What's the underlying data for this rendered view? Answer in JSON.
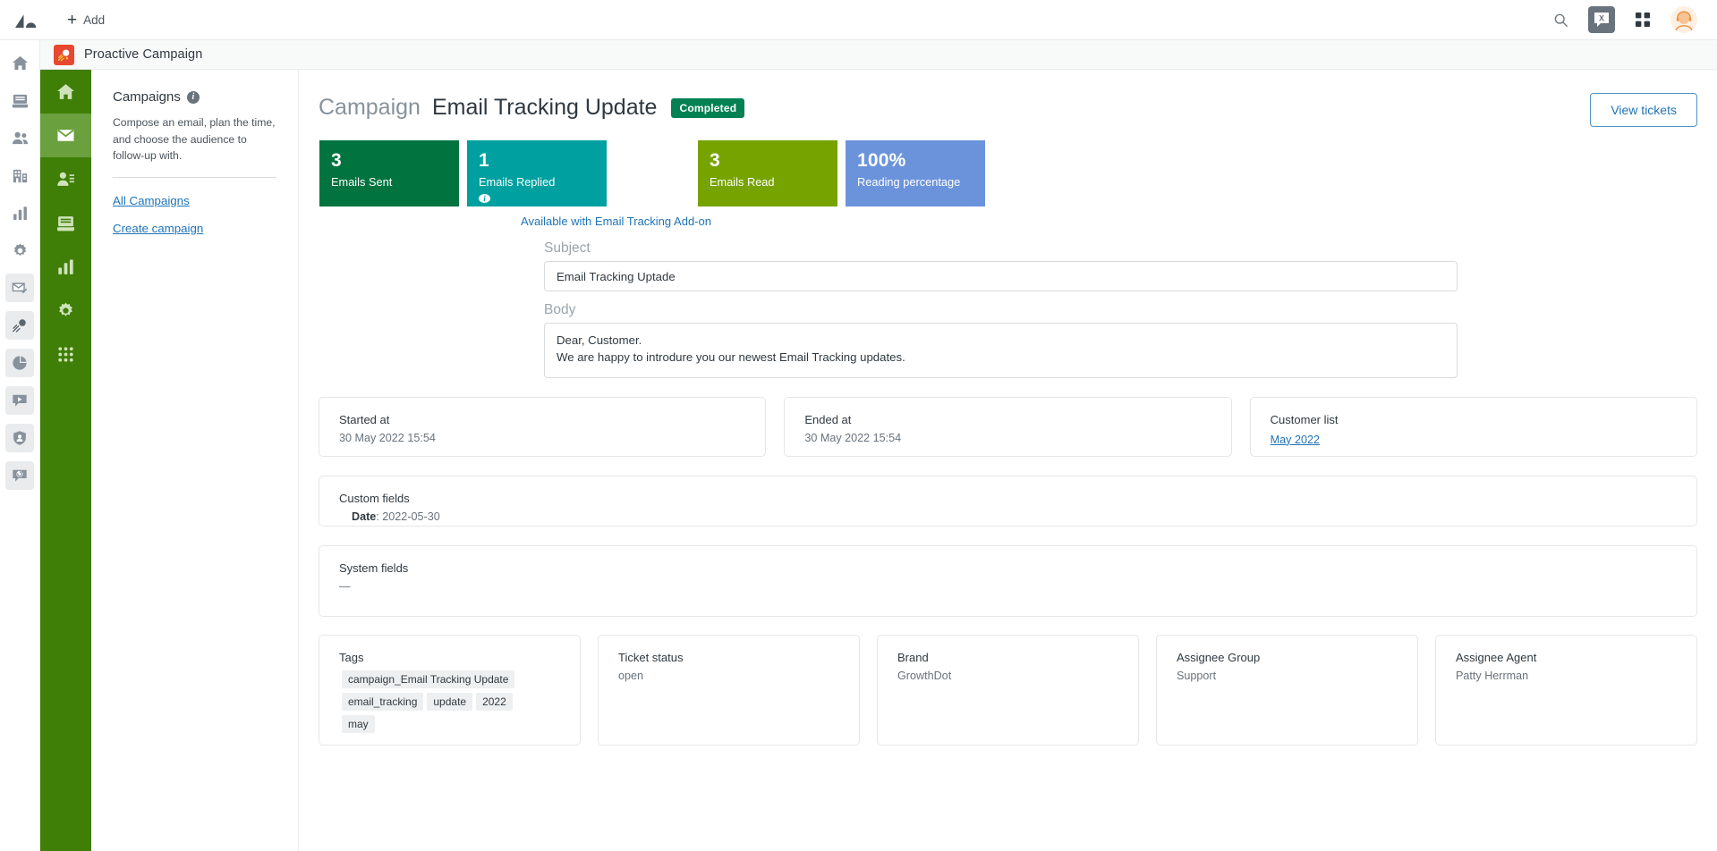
{
  "topbar": {
    "add_label": "Add",
    "icons": [
      {
        "name": "search-icon",
        "label": "Search"
      },
      {
        "name": "apps-tile-icon",
        "label": "Zendesk Apps"
      },
      {
        "name": "grid-icon",
        "label": "Products"
      },
      {
        "name": "avatar",
        "label": "User profile"
      }
    ]
  },
  "rail": {
    "items": [
      {
        "name": "home-icon",
        "label": "Home",
        "tile": false
      },
      {
        "name": "views-icon",
        "label": "Views",
        "tile": false
      },
      {
        "name": "customers-icon",
        "label": "Customers",
        "tile": false
      },
      {
        "name": "organizations-icon",
        "label": "Organizations",
        "tile": false
      },
      {
        "name": "reporting-icon",
        "label": "Reporting",
        "tile": false
      },
      {
        "name": "gear-icon",
        "label": "Admin",
        "tile": false
      },
      {
        "name": "email-tracking-icon",
        "label": "Email Tracking",
        "tile": true
      },
      {
        "name": "proactive-campaign-icon",
        "label": "Proactive Campaign",
        "tile": true
      },
      {
        "name": "pie-chart-icon",
        "label": "Analytics",
        "tile": true
      },
      {
        "name": "video-reply-icon",
        "label": "Video Reply",
        "tile": true
      },
      {
        "name": "shield-user-icon",
        "label": "GDPR Compliance",
        "tile": true
      },
      {
        "name": "ticket-share-icon",
        "label": "Ticket Sharing",
        "tile": true
      }
    ]
  },
  "product_header": {
    "title": "Proactive Campaign",
    "logo_name": "proactive-campaign-logo"
  },
  "greenbar": {
    "items": [
      {
        "name": "green-home-icon",
        "label": "Home",
        "active": false
      },
      {
        "name": "green-campaigns-icon",
        "label": "Campaigns",
        "active": true
      },
      {
        "name": "green-customer-lists-icon",
        "label": "Customer lists",
        "active": false
      },
      {
        "name": "green-templates-icon",
        "label": "Templates",
        "active": false
      },
      {
        "name": "green-reports-icon",
        "label": "Reports",
        "active": false
      },
      {
        "name": "green-settings-icon",
        "label": "Settings",
        "active": false
      },
      {
        "name": "green-apps-icon",
        "label": "Apps",
        "active": false
      }
    ]
  },
  "panel": {
    "title": "Campaigns",
    "description": "Compose an email, plan the time, and choose the audience to follow-up with.",
    "links": [
      {
        "label": "All Campaigns",
        "name": "all-campaigns-link"
      },
      {
        "label": "Create campaign",
        "name": "create-campaign-link"
      }
    ]
  },
  "page": {
    "breadcrumb_prefix": "Campaign",
    "title": "Email Tracking Update",
    "status_badge": "Completed",
    "view_tickets_label": "View tickets"
  },
  "stats": {
    "cards": [
      {
        "value": "3",
        "label": "Emails Sent",
        "color": "#00733f",
        "info": false
      },
      {
        "value": "1",
        "label": "Emails Replied",
        "color": "#00a0a0",
        "info": true
      },
      {
        "value": "3",
        "label": "Emails Read",
        "color": "#77a300",
        "info": false
      },
      {
        "value": "100%",
        "label": "Reading percentage",
        "color": "#6b93dc",
        "info": false
      }
    ],
    "addon_note": "Available with Email Tracking Add-on"
  },
  "form": {
    "subject_label": "Subject",
    "subject_value": "Email Tracking Uptade",
    "subject_placeholder": "Subject",
    "body_label": "Body",
    "body_line1": "Dear, Customer.",
    "body_line2": "We are happy to introdure you our newest Email Tracking updates.",
    "body_placeholder": "Body"
  },
  "meta_cards": [
    {
      "name": "started-at-card",
      "title": "Started at",
      "value": "30 May 2022 15:54",
      "link": false
    },
    {
      "name": "ended-at-card",
      "title": "Ended at",
      "value": "30 May 2022 15:54",
      "link": false
    },
    {
      "name": "customer-list-card",
      "title": "Customer list",
      "value": "May 2022",
      "link": true
    }
  ],
  "custom_fields": {
    "title": "Custom fields",
    "key": "Date",
    "value": "2022-05-30"
  },
  "system_fields": {
    "title": "System fields",
    "value": "—"
  },
  "bottom_cards": {
    "tags": {
      "title": "Tags",
      "items": [
        "campaign_Email Tracking Update",
        "email_tracking",
        "update",
        "2022",
        "may"
      ]
    },
    "ticket_status": {
      "title": "Ticket status",
      "value": "open"
    },
    "brand": {
      "title": "Brand",
      "value": "GrowthDot"
    },
    "assignee_group": {
      "title": "Assignee Group",
      "value": "Support"
    },
    "assignee_agent": {
      "title": "Assignee Agent",
      "value": "Patty Herrman"
    }
  },
  "colors": {
    "green_sidebar": "#3f7e07",
    "green_active": "#6aa03d",
    "badge_green": "#038153",
    "link_blue": "#1f73b7",
    "brand_red": "#e8482f"
  }
}
